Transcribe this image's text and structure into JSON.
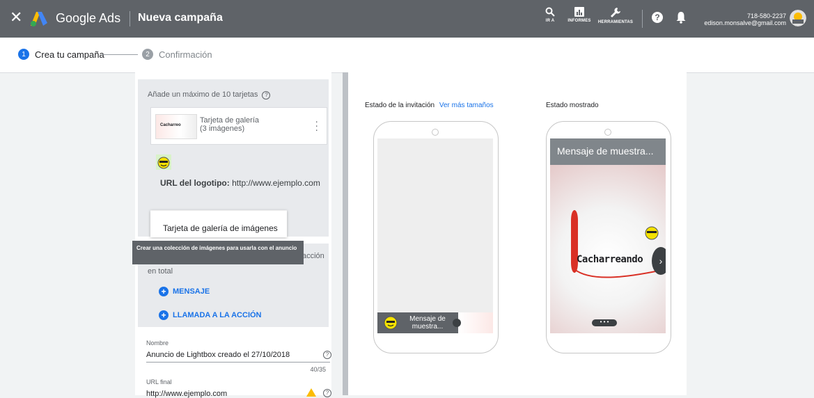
{
  "header": {
    "brand": "Google Ads",
    "page_title": "Nueva campaña",
    "tools": [
      {
        "label": "IR A",
        "icon": "search-icon"
      },
      {
        "label": "INFORMES",
        "icon": "reports-icon"
      },
      {
        "label": "HERRAMIENTAS",
        "icon": "wrench-icon"
      }
    ],
    "account_phone": "718-580-2237",
    "account_email": "edison.monsalve@gmail.com"
  },
  "stepper": {
    "step1_num": "1",
    "step1_label": "Crea tu campaña",
    "step2_num": "2",
    "step2_label": "Confirmación"
  },
  "editor": {
    "max_cards_hint": "Añade un máximo de 10 tarjetas",
    "gallery_card_title": "Tarjeta de galería",
    "gallery_card_sub": "(3 imágenes)",
    "thumb_text": "Cacharreo",
    "logo_url_label": "URL del logotipo:",
    "logo_url_value": "http://www.ejemplo.com",
    "dropdown_option": "Tarjeta de galería de imágenes",
    "tooltip": "Crear una colección de imágenes para usarla con el anuncio",
    "cta_tail": "acción",
    "cta_tail2": "en total",
    "add_message": "MENSAJE",
    "add_cta": "LLAMADA A LA ACCIÓN",
    "name_label": "Nombre",
    "name_value": "Anuncio de Lightbox creado el 27/10/2018",
    "name_counter": "40/35",
    "final_url_label": "URL final",
    "final_url_value": "http://www.ejemplo.com"
  },
  "preview": {
    "invite_label": "Estado de la invitación",
    "more_sizes_link": "Ver más tamaños",
    "shown_label": "Estado mostrado",
    "mini_message": "Mensaje de muestra...",
    "big_message": "Mensaje de muestra...",
    "image_text": "Cacharreando"
  },
  "colors": {
    "accent": "#1a73e8",
    "topbar": "#5f6368",
    "warning": "#fbbc04"
  }
}
